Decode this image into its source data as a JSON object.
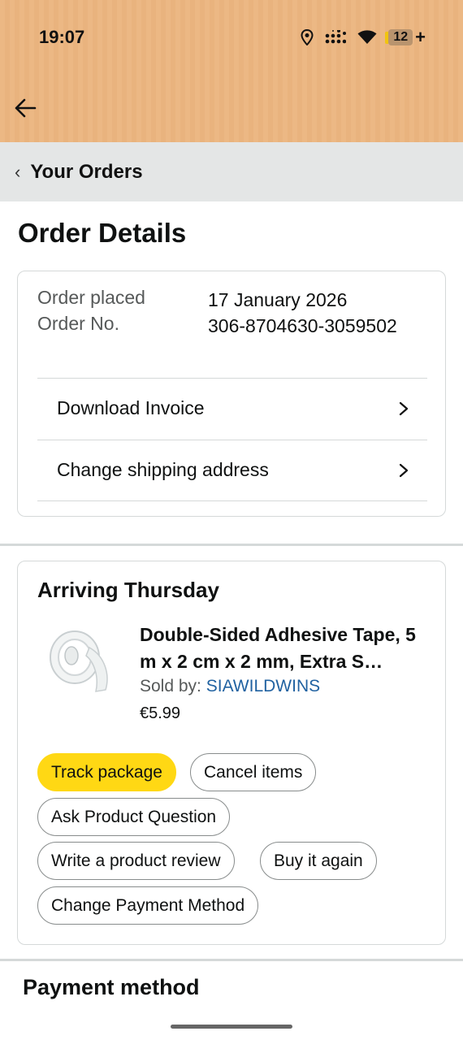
{
  "status_bar": {
    "time": "19:07",
    "battery": "12"
  },
  "nav": {
    "breadcrumb": "Your Orders"
  },
  "page": {
    "title": "Order Details"
  },
  "order": {
    "placed_label": "Order placed",
    "placed_value": "17 January 2026",
    "number_label": "Order No.",
    "number_value": "306-8704630-3059502",
    "links": [
      "Download Invoice",
      "Change shipping address"
    ]
  },
  "shipment": {
    "heading": "Arriving Thursday",
    "product_title": "Double-Sided Adhesive Tape, 5 m x 2 cm x 2 mm, Extra S…",
    "sold_by_label": "Sold by:",
    "seller": "SIAWILDWINS",
    "price": "€5.99",
    "buttons": {
      "track": "Track package",
      "cancel": "Cancel items",
      "ask": "Ask Product Question",
      "review": "Write a product review",
      "buy_again": "Buy it again",
      "payment": "Change Payment Method"
    }
  },
  "payment": {
    "heading": "Payment method"
  },
  "colors": {
    "accent_button": "#ffd814",
    "link": "#2162a1",
    "header": "#ecb884"
  }
}
